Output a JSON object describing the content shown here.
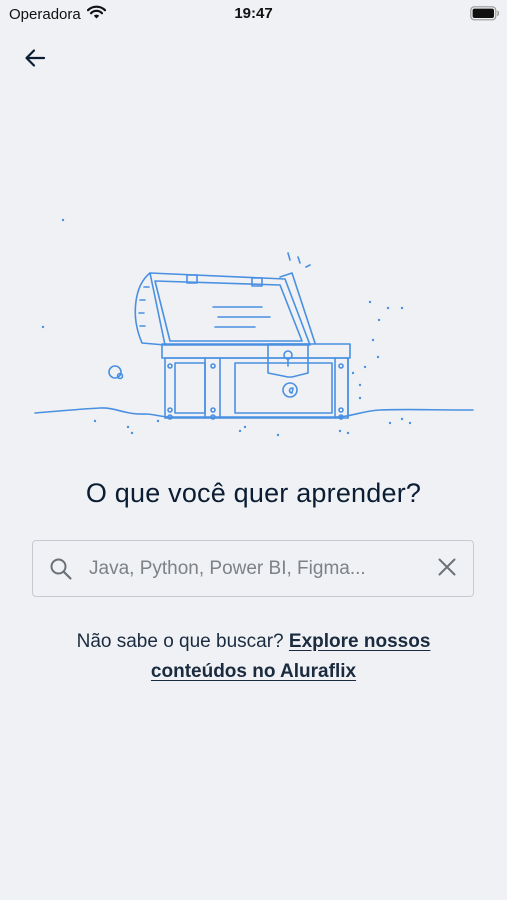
{
  "status_bar": {
    "carrier": "Operadora",
    "time": "19:47"
  },
  "header": {
    "back_icon": "arrow-left-icon"
  },
  "illustration": {
    "name": "treasure-chest-illustration",
    "stroke_color": "#4a90e2"
  },
  "main": {
    "heading": "O que você quer aprender?",
    "search": {
      "placeholder": "Java, Python, Power BI, Figma...",
      "value": "",
      "search_icon": "search-icon",
      "clear_icon": "close-icon"
    },
    "hint_text": "Não sabe o que buscar?",
    "hint_link": "Explore nossos conteúdos no Aluraflix"
  },
  "colors": {
    "background": "#eff1f4",
    "text_primary": "#0b1d33",
    "border": "#c7cbd1",
    "illustration": "#4a90e2"
  }
}
